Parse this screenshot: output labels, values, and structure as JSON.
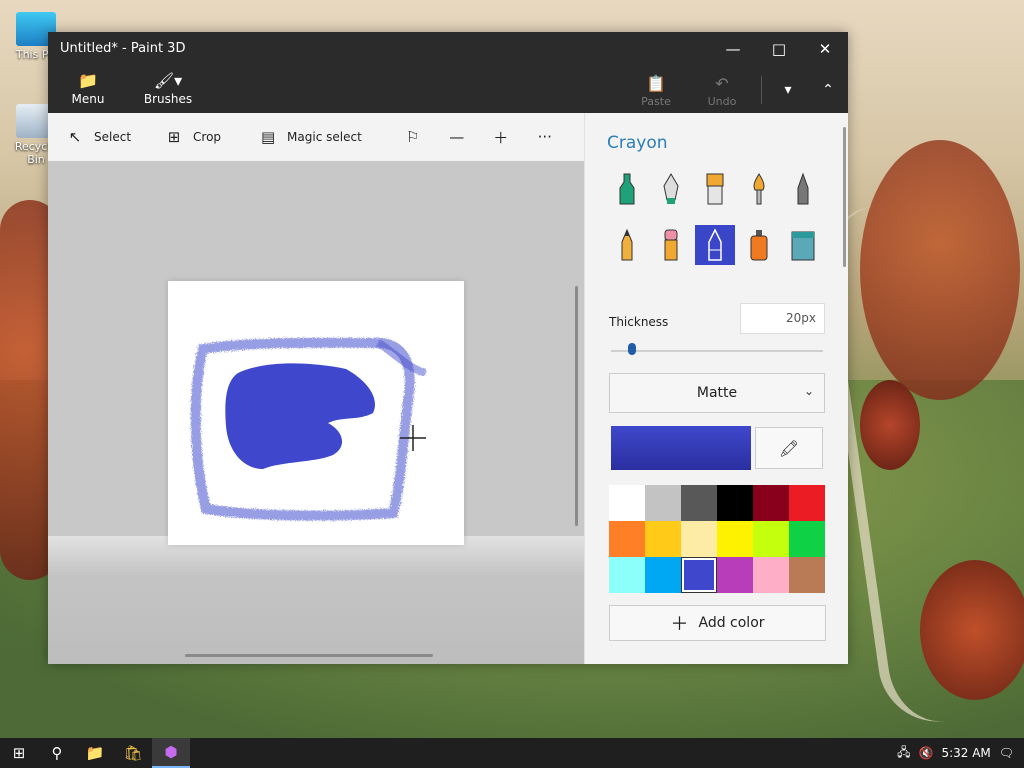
{
  "desktop": {
    "icons": [
      {
        "label": "This PC",
        "icon": "computer-icon"
      },
      {
        "label": "Recycle Bin",
        "icon": "recycle-bin-icon"
      }
    ]
  },
  "window": {
    "title": "Untitled* - Paint 3D",
    "menu_label": "Menu",
    "brushes_label": "Brushes",
    "paste_label": "Paste",
    "undo_label": "Undo"
  },
  "toolbar": {
    "select_label": "Select",
    "crop_label": "Crop",
    "magic_select_label": "Magic select",
    "more_label": "···"
  },
  "panel": {
    "title": "Crayon",
    "brushes": [
      "marker-icon",
      "calligraphy-pen-icon",
      "oil-brush-icon",
      "watercolor-icon",
      "pixel-pen-icon",
      "pencil-icon",
      "eraser-icon",
      "crayon-icon",
      "spray-can-icon",
      "fill-bucket-icon"
    ],
    "thickness_label": "Thickness",
    "thickness_value": "20px",
    "thickness_fraction": 0.1,
    "finish_value": "Matte",
    "selected_color": "#3f48cc",
    "palette": [
      "#ffffff",
      "#c3c3c3",
      "#585858",
      "#000000",
      "#88001b",
      "#ec1c24",
      "#ff7f27",
      "#ffca18",
      "#fdeca6",
      "#fff200",
      "#c4ff0e",
      "#0ed145",
      "#8cfffb",
      "#00a8f3",
      "#3f48cc",
      "#b83dba",
      "#ffaec8",
      "#b97a56"
    ],
    "add_color_label": "Add color"
  },
  "taskbar": {
    "time": "5:32 AM"
  }
}
